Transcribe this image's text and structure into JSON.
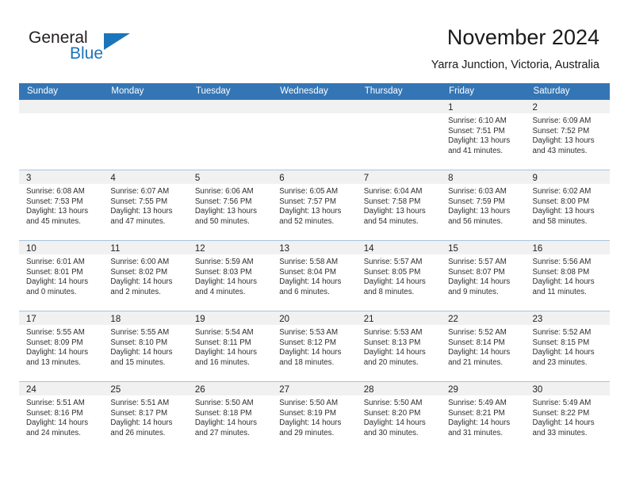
{
  "brand": {
    "word_one": "General",
    "word_two": "Blue",
    "accent_color": "#1b75bb"
  },
  "header": {
    "title": "November 2024",
    "location": "Yarra Junction, Victoria, Australia"
  },
  "calendar": {
    "header_bg": "#3476b5",
    "weekdays": [
      "Sunday",
      "Monday",
      "Tuesday",
      "Wednesday",
      "Thursday",
      "Friday",
      "Saturday"
    ],
    "weeks": [
      [
        {
          "day": "",
          "sunrise": "",
          "sunset": "",
          "daylight_line1": "",
          "daylight_line2": ""
        },
        {
          "day": "",
          "sunrise": "",
          "sunset": "",
          "daylight_line1": "",
          "daylight_line2": ""
        },
        {
          "day": "",
          "sunrise": "",
          "sunset": "",
          "daylight_line1": "",
          "daylight_line2": ""
        },
        {
          "day": "",
          "sunrise": "",
          "sunset": "",
          "daylight_line1": "",
          "daylight_line2": ""
        },
        {
          "day": "",
          "sunrise": "",
          "sunset": "",
          "daylight_line1": "",
          "daylight_line2": ""
        },
        {
          "day": "1",
          "sunrise": "Sunrise: 6:10 AM",
          "sunset": "Sunset: 7:51 PM",
          "daylight_line1": "Daylight: 13 hours",
          "daylight_line2": "and 41 minutes."
        },
        {
          "day": "2",
          "sunrise": "Sunrise: 6:09 AM",
          "sunset": "Sunset: 7:52 PM",
          "daylight_line1": "Daylight: 13 hours",
          "daylight_line2": "and 43 minutes."
        }
      ],
      [
        {
          "day": "3",
          "sunrise": "Sunrise: 6:08 AM",
          "sunset": "Sunset: 7:53 PM",
          "daylight_line1": "Daylight: 13 hours",
          "daylight_line2": "and 45 minutes."
        },
        {
          "day": "4",
          "sunrise": "Sunrise: 6:07 AM",
          "sunset": "Sunset: 7:55 PM",
          "daylight_line1": "Daylight: 13 hours",
          "daylight_line2": "and 47 minutes."
        },
        {
          "day": "5",
          "sunrise": "Sunrise: 6:06 AM",
          "sunset": "Sunset: 7:56 PM",
          "daylight_line1": "Daylight: 13 hours",
          "daylight_line2": "and 50 minutes."
        },
        {
          "day": "6",
          "sunrise": "Sunrise: 6:05 AM",
          "sunset": "Sunset: 7:57 PM",
          "daylight_line1": "Daylight: 13 hours",
          "daylight_line2": "and 52 minutes."
        },
        {
          "day": "7",
          "sunrise": "Sunrise: 6:04 AM",
          "sunset": "Sunset: 7:58 PM",
          "daylight_line1": "Daylight: 13 hours",
          "daylight_line2": "and 54 minutes."
        },
        {
          "day": "8",
          "sunrise": "Sunrise: 6:03 AM",
          "sunset": "Sunset: 7:59 PM",
          "daylight_line1": "Daylight: 13 hours",
          "daylight_line2": "and 56 minutes."
        },
        {
          "day": "9",
          "sunrise": "Sunrise: 6:02 AM",
          "sunset": "Sunset: 8:00 PM",
          "daylight_line1": "Daylight: 13 hours",
          "daylight_line2": "and 58 minutes."
        }
      ],
      [
        {
          "day": "10",
          "sunrise": "Sunrise: 6:01 AM",
          "sunset": "Sunset: 8:01 PM",
          "daylight_line1": "Daylight: 14 hours",
          "daylight_line2": "and 0 minutes."
        },
        {
          "day": "11",
          "sunrise": "Sunrise: 6:00 AM",
          "sunset": "Sunset: 8:02 PM",
          "daylight_line1": "Daylight: 14 hours",
          "daylight_line2": "and 2 minutes."
        },
        {
          "day": "12",
          "sunrise": "Sunrise: 5:59 AM",
          "sunset": "Sunset: 8:03 PM",
          "daylight_line1": "Daylight: 14 hours",
          "daylight_line2": "and 4 minutes."
        },
        {
          "day": "13",
          "sunrise": "Sunrise: 5:58 AM",
          "sunset": "Sunset: 8:04 PM",
          "daylight_line1": "Daylight: 14 hours",
          "daylight_line2": "and 6 minutes."
        },
        {
          "day": "14",
          "sunrise": "Sunrise: 5:57 AM",
          "sunset": "Sunset: 8:05 PM",
          "daylight_line1": "Daylight: 14 hours",
          "daylight_line2": "and 8 minutes."
        },
        {
          "day": "15",
          "sunrise": "Sunrise: 5:57 AM",
          "sunset": "Sunset: 8:07 PM",
          "daylight_line1": "Daylight: 14 hours",
          "daylight_line2": "and 9 minutes."
        },
        {
          "day": "16",
          "sunrise": "Sunrise: 5:56 AM",
          "sunset": "Sunset: 8:08 PM",
          "daylight_line1": "Daylight: 14 hours",
          "daylight_line2": "and 11 minutes."
        }
      ],
      [
        {
          "day": "17",
          "sunrise": "Sunrise: 5:55 AM",
          "sunset": "Sunset: 8:09 PM",
          "daylight_line1": "Daylight: 14 hours",
          "daylight_line2": "and 13 minutes."
        },
        {
          "day": "18",
          "sunrise": "Sunrise: 5:55 AM",
          "sunset": "Sunset: 8:10 PM",
          "daylight_line1": "Daylight: 14 hours",
          "daylight_line2": "and 15 minutes."
        },
        {
          "day": "19",
          "sunrise": "Sunrise: 5:54 AM",
          "sunset": "Sunset: 8:11 PM",
          "daylight_line1": "Daylight: 14 hours",
          "daylight_line2": "and 16 minutes."
        },
        {
          "day": "20",
          "sunrise": "Sunrise: 5:53 AM",
          "sunset": "Sunset: 8:12 PM",
          "daylight_line1": "Daylight: 14 hours",
          "daylight_line2": "and 18 minutes."
        },
        {
          "day": "21",
          "sunrise": "Sunrise: 5:53 AM",
          "sunset": "Sunset: 8:13 PM",
          "daylight_line1": "Daylight: 14 hours",
          "daylight_line2": "and 20 minutes."
        },
        {
          "day": "22",
          "sunrise": "Sunrise: 5:52 AM",
          "sunset": "Sunset: 8:14 PM",
          "daylight_line1": "Daylight: 14 hours",
          "daylight_line2": "and 21 minutes."
        },
        {
          "day": "23",
          "sunrise": "Sunrise: 5:52 AM",
          "sunset": "Sunset: 8:15 PM",
          "daylight_line1": "Daylight: 14 hours",
          "daylight_line2": "and 23 minutes."
        }
      ],
      [
        {
          "day": "24",
          "sunrise": "Sunrise: 5:51 AM",
          "sunset": "Sunset: 8:16 PM",
          "daylight_line1": "Daylight: 14 hours",
          "daylight_line2": "and 24 minutes."
        },
        {
          "day": "25",
          "sunrise": "Sunrise: 5:51 AM",
          "sunset": "Sunset: 8:17 PM",
          "daylight_line1": "Daylight: 14 hours",
          "daylight_line2": "and 26 minutes."
        },
        {
          "day": "26",
          "sunrise": "Sunrise: 5:50 AM",
          "sunset": "Sunset: 8:18 PM",
          "daylight_line1": "Daylight: 14 hours",
          "daylight_line2": "and 27 minutes."
        },
        {
          "day": "27",
          "sunrise": "Sunrise: 5:50 AM",
          "sunset": "Sunset: 8:19 PM",
          "daylight_line1": "Daylight: 14 hours",
          "daylight_line2": "and 29 minutes."
        },
        {
          "day": "28",
          "sunrise": "Sunrise: 5:50 AM",
          "sunset": "Sunset: 8:20 PM",
          "daylight_line1": "Daylight: 14 hours",
          "daylight_line2": "and 30 minutes."
        },
        {
          "day": "29",
          "sunrise": "Sunrise: 5:49 AM",
          "sunset": "Sunset: 8:21 PM",
          "daylight_line1": "Daylight: 14 hours",
          "daylight_line2": "and 31 minutes."
        },
        {
          "day": "30",
          "sunrise": "Sunrise: 5:49 AM",
          "sunset": "Sunset: 8:22 PM",
          "daylight_line1": "Daylight: 14 hours",
          "daylight_line2": "and 33 minutes."
        }
      ]
    ]
  }
}
